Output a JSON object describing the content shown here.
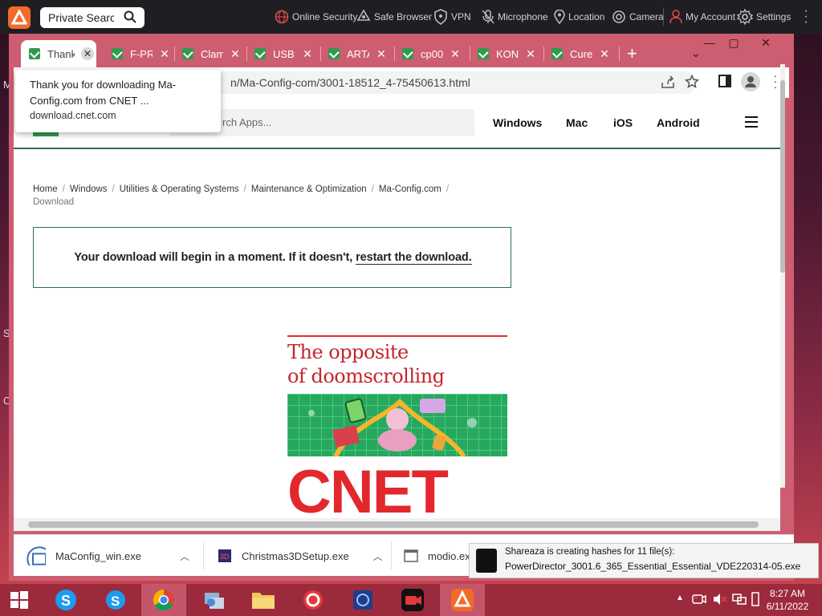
{
  "desktop": {
    "labels": [
      "M",
      "S",
      "C"
    ]
  },
  "topbar": {
    "search_placeholder": "Private Search",
    "items": [
      {
        "label": "Online Security",
        "icon": "globe-shield-icon"
      },
      {
        "label": "Safe Browser",
        "icon": "browser-icon"
      },
      {
        "label": "VPN",
        "icon": "vpn-shield-icon"
      },
      {
        "label": "Microphone",
        "icon": "microphone-icon"
      },
      {
        "label": "Location",
        "icon": "location-icon"
      },
      {
        "label": "Camera",
        "icon": "camera-icon"
      },
      {
        "label": "My Account",
        "icon": "user-icon"
      },
      {
        "label": "Settings",
        "icon": "gear-icon"
      }
    ]
  },
  "tabs": [
    {
      "title": "Thank"
    },
    {
      "title": "F-PRO"
    },
    {
      "title": "Clam"
    },
    {
      "title": "USB D"
    },
    {
      "title": "ARTA"
    },
    {
      "title": "cp00"
    },
    {
      "title": "KONI"
    },
    {
      "title": "Cure"
    }
  ],
  "address": {
    "url": "n/Ma-Config-com/3001-18512_4-75450613.html"
  },
  "cnet": {
    "search_placeholder": "rch Apps...",
    "nav": [
      "Windows",
      "Mac",
      "iOS",
      "Android"
    ],
    "breadcrumb": [
      "Home",
      "Windows",
      "Utilities & Operating Systems",
      "Maintenance & Optimization",
      "Ma-Config.com"
    ],
    "breadcrumb_current": "Download",
    "download_msg": "Your download will begin in a moment. If it doesn't,",
    "restart_link": "restart the download.",
    "ad_headline_1": "The opposite",
    "ad_headline_2": "of doomscrolling",
    "ad_logo": "CNET"
  },
  "tooltip": {
    "line1": "Thank you for downloading Ma-Config.com from CNET ...",
    "line2": "download.cnet.com"
  },
  "downloads": [
    {
      "name": "MaConfig_win.exe"
    },
    {
      "name": "Christmas3DSetup.exe"
    },
    {
      "name": "modio.exe"
    }
  ],
  "toast": {
    "line1": "Shareaza is creating hashes for 11 file(s):",
    "line2": "PowerDirector_3001.6_365_Essential_Essential_VDE220314-05.exe"
  },
  "taskbar": {
    "time": "8:27 AM",
    "date": "6/11/2022"
  },
  "colors": {
    "avast_orange": "#f26b2a",
    "browser_frame": "#cd5d70",
    "cnet_red": "#e2282d",
    "cnet_green": "#2e6e55",
    "taskbar": "#9c2a3d"
  }
}
